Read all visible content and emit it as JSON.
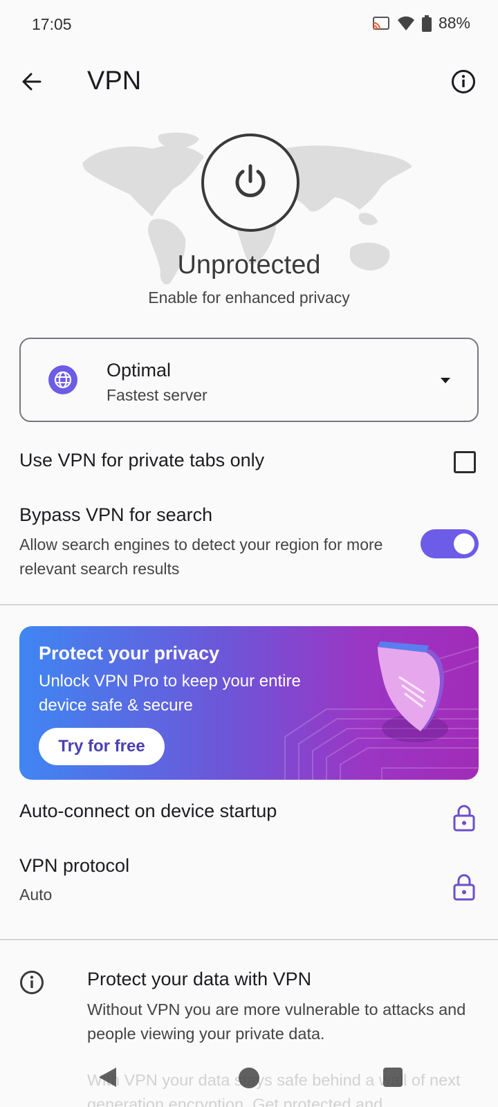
{
  "status_bar": {
    "time": "17:05",
    "battery": "88%",
    "icons": [
      "cast-icon",
      "wifi-icon",
      "battery-icon"
    ]
  },
  "app_bar": {
    "title": "VPN",
    "icons": [
      "back-arrow-icon",
      "info-icon"
    ]
  },
  "hero": {
    "status": "Unprotected",
    "subtitle": "Enable for enhanced privacy",
    "icons": [
      "power-icon",
      "world-map"
    ]
  },
  "server": {
    "name": "Optimal",
    "subtitle": "Fastest server",
    "icons": [
      "globe-icon",
      "dropdown-arrow-icon"
    ]
  },
  "settings": {
    "private_tabs": {
      "label": "Use VPN for private tabs only",
      "checked": false
    },
    "bypass_search": {
      "label": "Bypass VPN for search",
      "description": "Allow search engines to detect your region for more relevant search results",
      "enabled": true
    }
  },
  "promo": {
    "title": "Protect your privacy",
    "text": "Unlock VPN Pro to keep your entire device safe & secure",
    "button": "Try for free"
  },
  "pro_settings": {
    "auto_connect": {
      "label": "Auto-connect on device startup",
      "locked": true
    },
    "protocol": {
      "label": "VPN protocol",
      "value": "Auto",
      "locked": true
    }
  },
  "info": {
    "title": "Protect your data with VPN",
    "text": "Without VPN you are more vulnerable to attacks and people viewing your private data.",
    "text_faded": "With VPN your data stays safe behind a wall of next generation encryption. Get protected and"
  },
  "colors": {
    "accent": "#6c5ce7",
    "promo_gradient_start": "#3f86f2",
    "promo_gradient_end": "#a12cb8",
    "lock": "#6c4fc7"
  }
}
